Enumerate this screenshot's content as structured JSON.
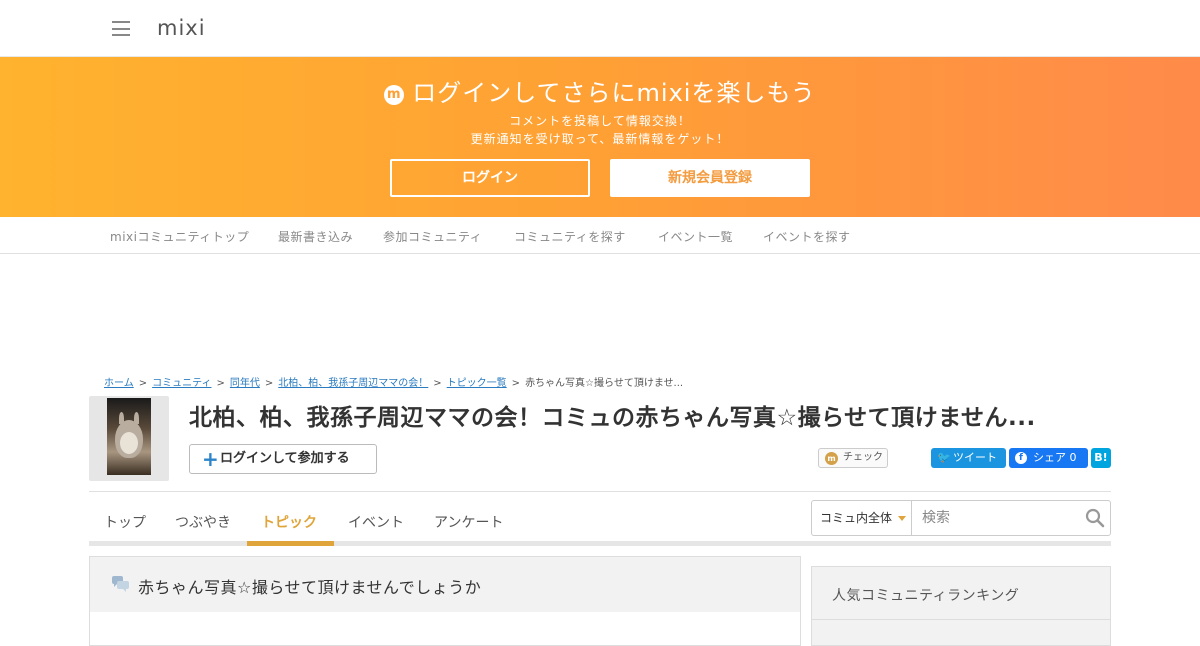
{
  "header": {
    "logo_text": "mixi"
  },
  "banner": {
    "title": "ログインしてさらにmixiを楽しもう",
    "icon_glyph": "m",
    "sub_line1": "コメントを投稿して情報交換！",
    "sub_line2": "更新通知を受け取って、最新情報をゲット！",
    "login_label": "ログイン",
    "register_label": "新規会員登録"
  },
  "subnav": {
    "items": [
      {
        "label": "mixiコミュニティトップ"
      },
      {
        "label": "最新書き込み"
      },
      {
        "label": "参加コミュニティ"
      },
      {
        "label": "コミュニティを探す"
      },
      {
        "label": "イベント一覧"
      },
      {
        "label": "イベントを探す"
      }
    ]
  },
  "breadcrumb": {
    "items": [
      {
        "label": "ホーム"
      },
      {
        "label": "コミュニティ"
      },
      {
        "label": "同年代"
      },
      {
        "label": "北柏、柏、我孫子周辺ママの会！"
      },
      {
        "label": "トピック一覧"
      }
    ],
    "current": "赤ちゃん写真☆撮らせて頂けませ...",
    "separator": ">"
  },
  "community": {
    "title": "北柏、柏、我孫子周辺ママの会！コミュの赤ちゃん写真☆撮らせて頂けません...",
    "join_label": "ログインして参加する",
    "join_icon_glyph": "+"
  },
  "share": {
    "check_label": "チェック",
    "check_icon_glyph": "m",
    "tweet_label": "ツイート",
    "tweet_icon_glyph": "🐦",
    "fb_label": "シェア 0",
    "fb_icon_glyph": "f",
    "hatena_label": "B!"
  },
  "tabs": {
    "items": [
      {
        "label": "トップ"
      },
      {
        "label": "つぶやき"
      },
      {
        "label": "トピック"
      },
      {
        "label": "イベント"
      },
      {
        "label": "アンケート"
      }
    ],
    "active": "トピック"
  },
  "search": {
    "scope_label": "コミュ内全体",
    "placeholder": "検索"
  },
  "topic": {
    "title": "赤ちゃん写真☆撮らせて頂けませんでしょうか"
  },
  "sidebar": {
    "title": "人気コミュニティランキング"
  },
  "colors": {
    "banner_start": "#ffb32e",
    "banner_end": "#ff8a4a",
    "accent": "#e0a53a",
    "link": "#2a7bbf",
    "twitter": "#1b95e0",
    "facebook": "#1877f2",
    "hatena": "#00a4de"
  }
}
